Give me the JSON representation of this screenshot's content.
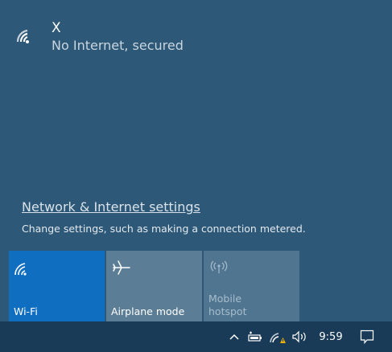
{
  "network": {
    "name": "X",
    "status": "No Internet, secured",
    "icon": "wifi-warning-icon"
  },
  "settings": {
    "link": "Network & Internet settings",
    "description": "Change settings, such as making a connection metered."
  },
  "tiles": [
    {
      "label": "Wi-Fi",
      "icon": "wifi-icon",
      "state": "on",
      "color": "#0f6ec0"
    },
    {
      "label": "Airplane mode",
      "icon": "airplane-icon",
      "state": "off",
      "color": "#5b7d96"
    },
    {
      "label": "Mobile\nhotspot",
      "icon": "hotspot-icon",
      "state": "disabled",
      "color": "#4f7591"
    }
  ],
  "taskbar": {
    "clock": "9:59",
    "icons": [
      "chevron-up-icon",
      "battery-icon",
      "wifi-warning-icon",
      "volume-icon",
      "notification-icon"
    ],
    "background": "#1a3b57"
  },
  "colors": {
    "flyout_bg": "#2d5877",
    "accent": "#0f6ec0",
    "warning": "#f2b200"
  }
}
